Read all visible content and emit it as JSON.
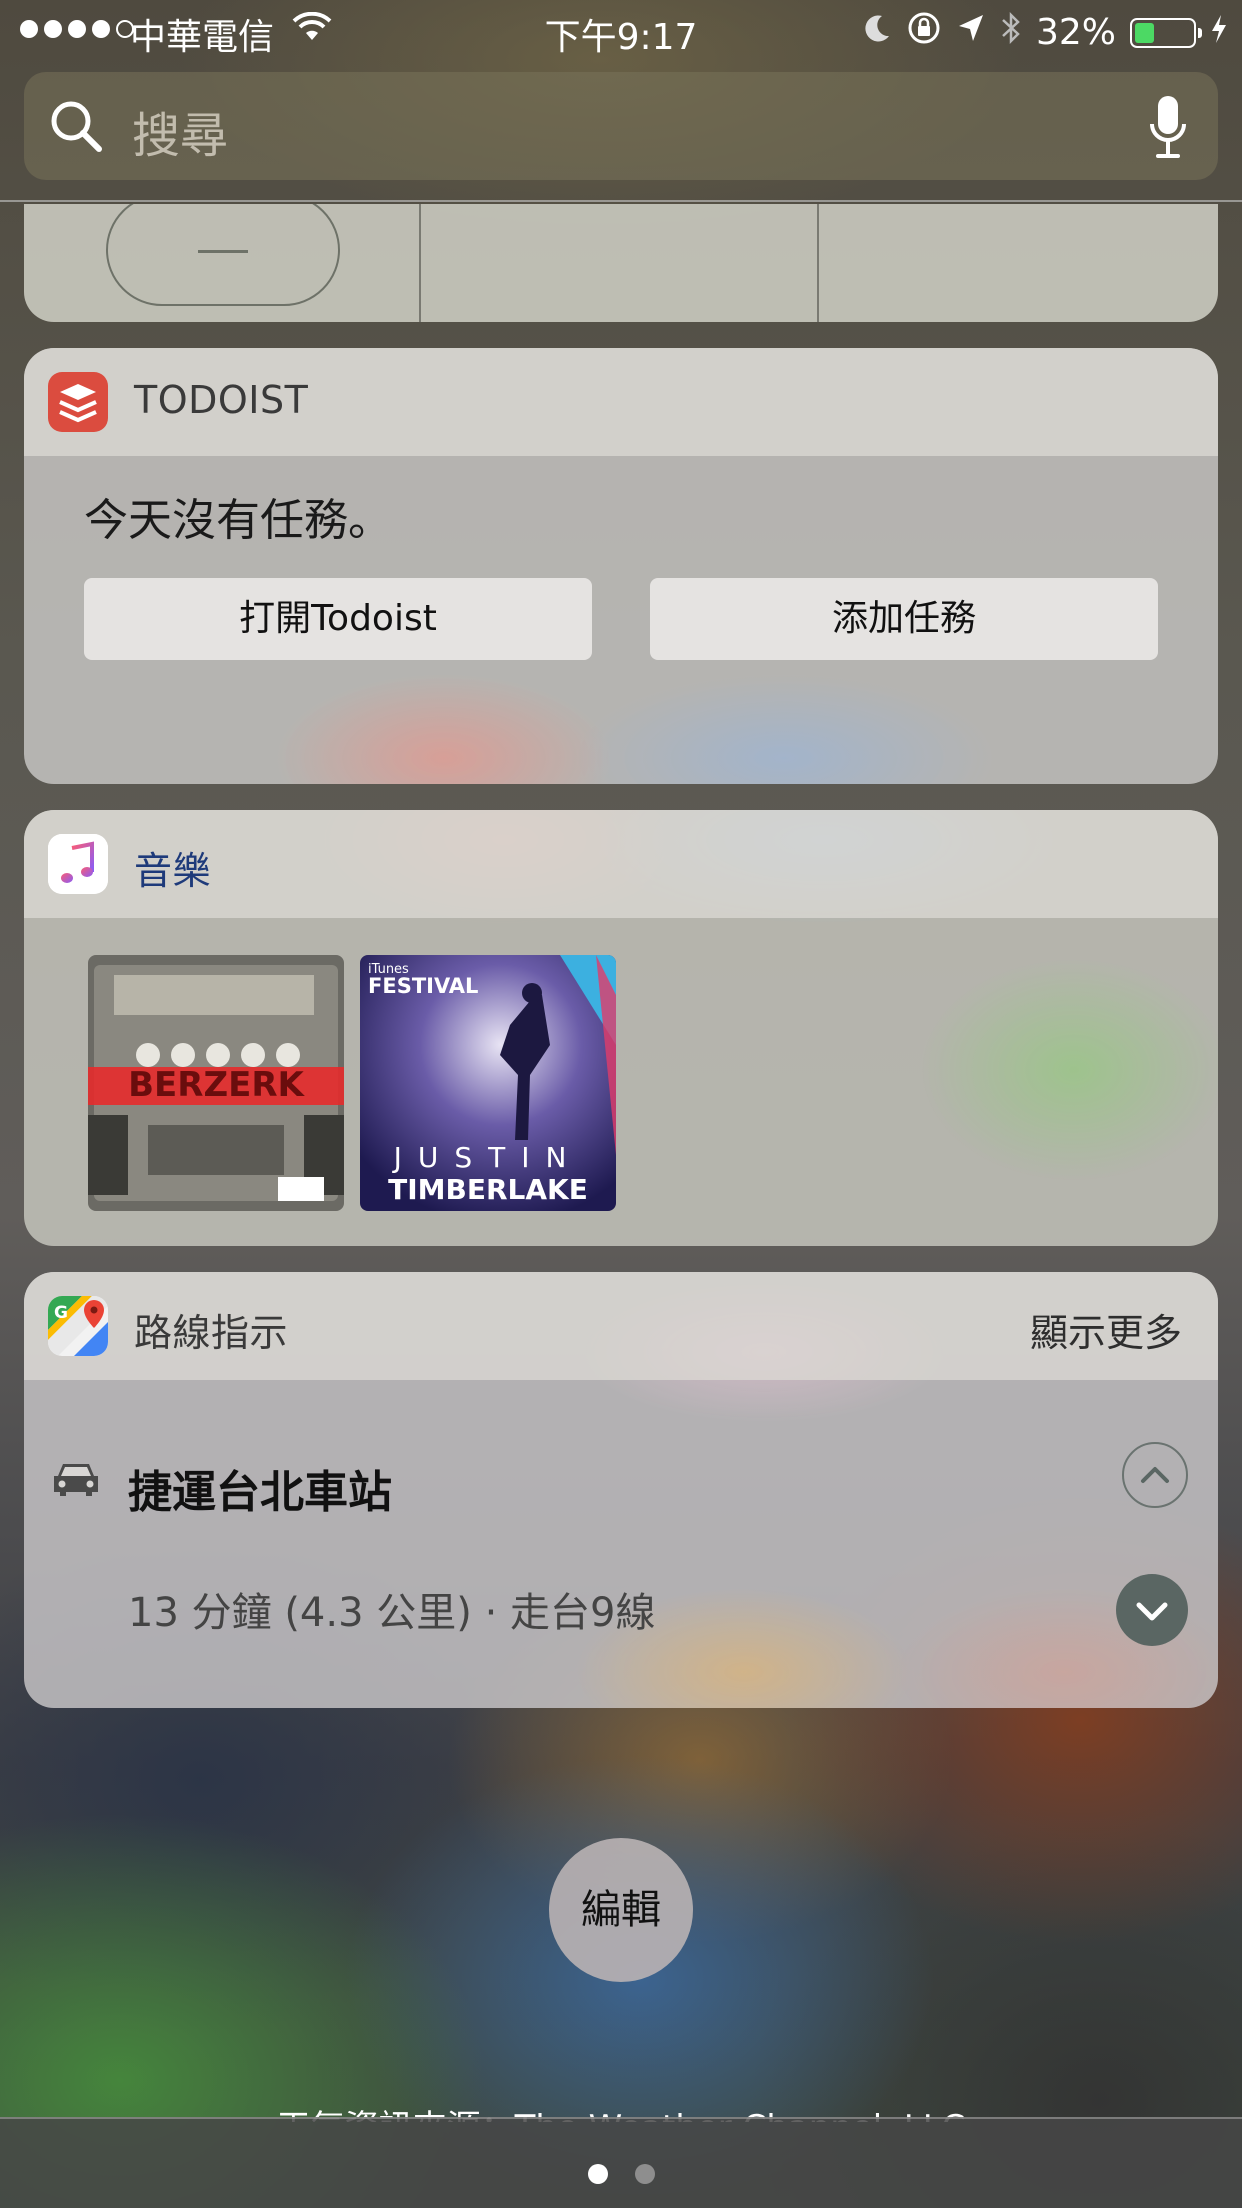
{
  "status_bar": {
    "carrier": "中華電信",
    "time": "下午9:17",
    "battery_percent": "32%",
    "battery_level": 0.32,
    "signal_bars_filled": 4,
    "signal_bars_total": 5
  },
  "search": {
    "placeholder": "搜尋"
  },
  "todoist": {
    "title": "TODOIST",
    "empty_message": "今天沒有任務。",
    "open_button": "打開Todoist",
    "add_button": "添加任務"
  },
  "music": {
    "title": "音樂",
    "albums": [
      {
        "art_text": "BERZERK"
      },
      {
        "art_brand": "iTunes",
        "art_event": "FESTIVAL",
        "art_line1": "JUSTIN",
        "art_line2": "TIMBERLAKE"
      }
    ]
  },
  "maps": {
    "title": "路線指示",
    "show_more": "顯示更多",
    "destination": "捷運台北車站",
    "route_info": "13 分鐘 (4.3 公里) · 走台9線"
  },
  "edit_button": "編輯",
  "weather_credit": "天氣資訊來源：The Weather Channel, LLC",
  "colors": {
    "battery_fill": "#4cd964",
    "todoist_red": "#db4c3f"
  },
  "pages": {
    "current": 1,
    "total": 2
  }
}
